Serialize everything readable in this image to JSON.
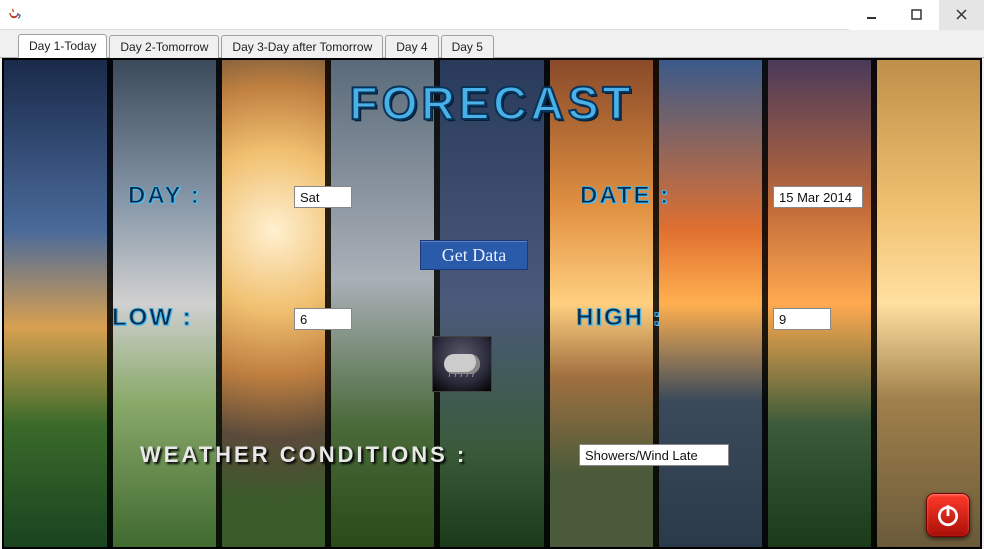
{
  "window": {
    "title": ""
  },
  "tabs": [
    {
      "label": "Day 1-Today"
    },
    {
      "label": "Day 2-Tomorrow"
    },
    {
      "label": "Day 3-Day after Tomorrow"
    },
    {
      "label": "Day 4"
    },
    {
      "label": "Day 5"
    }
  ],
  "active_tab_index": 0,
  "title": "FORECAST",
  "labels": {
    "day": "DAY :",
    "date": "DATE :",
    "low": "LOW :",
    "high": "HIGH :",
    "conditions": "WEATHER CONDITIONS  :"
  },
  "values": {
    "day": "Sat",
    "date": "15 Mar 2014",
    "low": "6",
    "high": "9",
    "conditions": "Showers/Wind Late"
  },
  "buttons": {
    "get_data": "Get Data"
  },
  "icons": {
    "weather": "showers-icon",
    "power": "power-icon",
    "java": "java-icon"
  },
  "colors": {
    "accent_blue": "#4ab0e8",
    "button_blue": "#2a5aaa",
    "power_red": "#ff3a2a"
  }
}
